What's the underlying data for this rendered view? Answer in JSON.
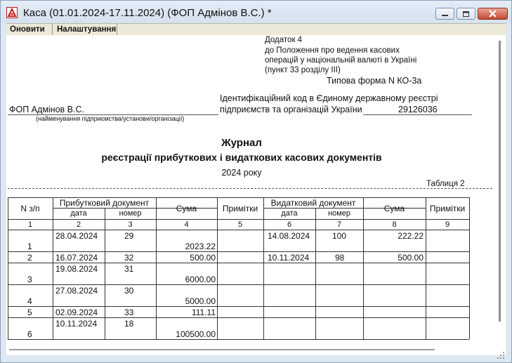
{
  "window": {
    "title": "Каса (01.01.2024-17.11.2024) (ФОП Адмінов В.С.)  *"
  },
  "menu": {
    "refresh_label": "Оновити",
    "settings_label": "Налаштування"
  },
  "report": {
    "appendix": [
      "Додаток 4",
      "до Положення про ведення касових",
      "операцій у національній валюті в Україні",
      "(пункт 33 розділу ІІІ)"
    ],
    "form_type": "Типова форма N КО-3а",
    "organization": "ФОП Адмінов В.С.",
    "organization_caption": "(найменування підприємства/установи/організації)",
    "id_code_label_1": "Ідентифікаційний код в Єдиному державному реєстрі",
    "id_code_label_2": "підприємств та організацій України",
    "id_code": "29126036",
    "heading": "Журнал",
    "subheading": "реєстрації прибуткових і видаткових касових документів",
    "year": "2024 року",
    "table_label": "Таблиця 2"
  },
  "table": {
    "header": {
      "num": "N з/п",
      "income_doc": "Прибутковий документ",
      "date": "дата",
      "number": "номер",
      "amount": "Сума",
      "notes": "Примітки",
      "expense_doc": "Видатковий документ"
    },
    "column_numbers": [
      "1",
      "2",
      "3",
      "4",
      "5",
      "6",
      "7",
      "8",
      "9"
    ],
    "rows": [
      {
        "n": "1",
        "in_date": "28.04.2024",
        "in_num": "29",
        "in_sum": "2023.22",
        "ex_date": "14.08.2024",
        "ex_num": "100",
        "ex_sum": "222.22"
      },
      {
        "n": "2",
        "in_date": "16.07.2024",
        "in_num": "32",
        "in_sum": "500.00",
        "ex_date": "10.11.2024",
        "ex_num": "98",
        "ex_sum": "500.00"
      },
      {
        "n": "3",
        "in_date": "19.08.2024",
        "in_num": "31",
        "in_sum": "6000.00",
        "ex_date": "",
        "ex_num": "",
        "ex_sum": ""
      },
      {
        "n": "4",
        "in_date": "27.08.2024",
        "in_num": "30",
        "in_sum": "5000.00",
        "ex_date": "",
        "ex_num": "",
        "ex_sum": ""
      },
      {
        "n": "5",
        "in_date": "02.09.2024",
        "in_num": "33",
        "in_sum": "111.11",
        "ex_date": "",
        "ex_num": "",
        "ex_sum": ""
      },
      {
        "n": "6",
        "in_date": "10.11.2024",
        "in_num": "18",
        "in_sum": "100500.00",
        "ex_date": "",
        "ex_num": "",
        "ex_sum": ""
      }
    ]
  }
}
